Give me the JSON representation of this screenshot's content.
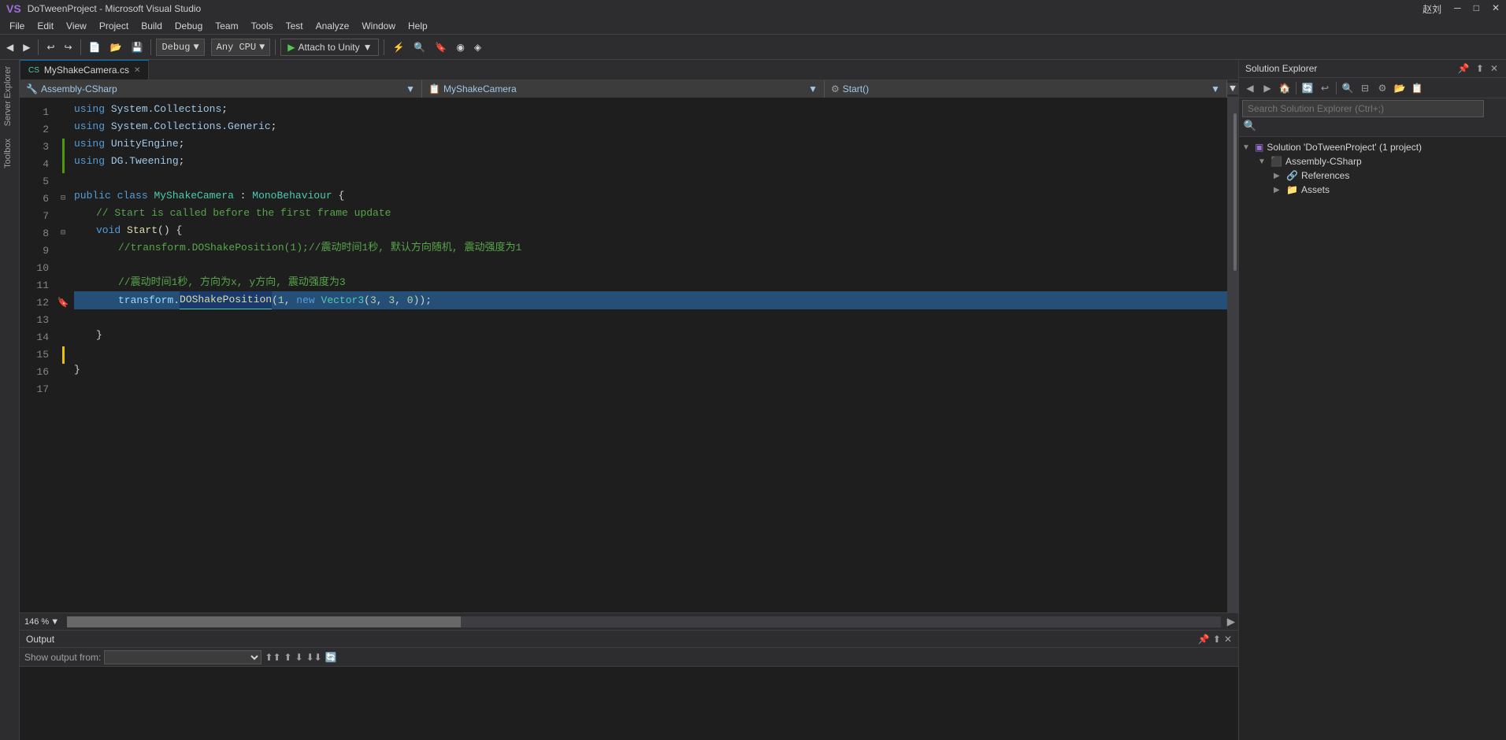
{
  "titleBar": {
    "logo": "VS",
    "title": "DoTweenProject - Microsoft Visual Studio"
  },
  "menuBar": {
    "items": [
      "File",
      "Edit",
      "View",
      "Project",
      "Build",
      "Debug",
      "Team",
      "Tools",
      "Test",
      "Analyze",
      "Window",
      "Help"
    ]
  },
  "toolbar": {
    "backLabel": "◀",
    "forwardLabel": "▶",
    "debugConfig": "Debug",
    "platform": "Any CPU",
    "attachLabel": "Attach to Unity",
    "userLabel": "赵刘",
    "rightControls": "⚙"
  },
  "tabBar": {
    "tabs": [
      {
        "name": "MyShakeCamera.cs",
        "active": true
      },
      {
        "name": "+",
        "active": false
      }
    ]
  },
  "navBar": {
    "assembly": "Assembly-CSharp",
    "class": "MyShakeCamera",
    "method": "Start()"
  },
  "codeLines": [
    {
      "num": 1,
      "content": "using System.Collections;",
      "type": "using"
    },
    {
      "num": 2,
      "content": "using System.Collections.Generic;",
      "type": "using"
    },
    {
      "num": 3,
      "content": "using UnityEngine;",
      "type": "using"
    },
    {
      "num": 4,
      "content": "using DG.Tweening;",
      "type": "using"
    },
    {
      "num": 5,
      "content": "",
      "type": "empty"
    },
    {
      "num": 6,
      "content": "public class MyShakeCamera : MonoBehaviour {",
      "type": "class"
    },
    {
      "num": 7,
      "content": "    // Start is called before the first frame update",
      "type": "comment"
    },
    {
      "num": 8,
      "content": "    void Start() {",
      "type": "method"
    },
    {
      "num": 9,
      "content": "        //transform.DOShakePosition(1);//震动时间1秒, 默认方向随机, 震动强度为1",
      "type": "comment"
    },
    {
      "num": 10,
      "content": "",
      "type": "empty"
    },
    {
      "num": 11,
      "content": "        //震动时间1秒, 方向为x, y方向, 震动强度为3",
      "type": "comment"
    },
    {
      "num": 12,
      "content": "        transform.DOShakePosition(1, new Vector3(3, 3, 0));",
      "type": "highlighted"
    },
    {
      "num": 13,
      "content": "",
      "type": "empty"
    },
    {
      "num": 14,
      "content": "    }",
      "type": "normal"
    },
    {
      "num": 15,
      "content": "",
      "type": "empty"
    },
    {
      "num": 16,
      "content": "}",
      "type": "normal"
    },
    {
      "num": 17,
      "content": "",
      "type": "empty"
    }
  ],
  "solutionExplorer": {
    "title": "Solution Explorer",
    "searchPlaceholder": "Search Solution Explorer (Ctrl+;)",
    "tree": [
      {
        "level": 0,
        "icon": "solution",
        "label": "Solution 'DoTweenProject' (1 project)",
        "expanded": true
      },
      {
        "level": 1,
        "icon": "project",
        "label": "Assembly-CSharp",
        "expanded": true
      },
      {
        "level": 2,
        "icon": "references",
        "label": "References",
        "expanded": false
      },
      {
        "level": 2,
        "icon": "folder",
        "label": "Assets",
        "expanded": false
      }
    ]
  },
  "outputPanel": {
    "title": "Output",
    "showOutputFrom": "Show output from:",
    "dropdownValue": ""
  },
  "statusBar": {
    "zoom": "146 %",
    "zoomDownArrow": "▼"
  }
}
